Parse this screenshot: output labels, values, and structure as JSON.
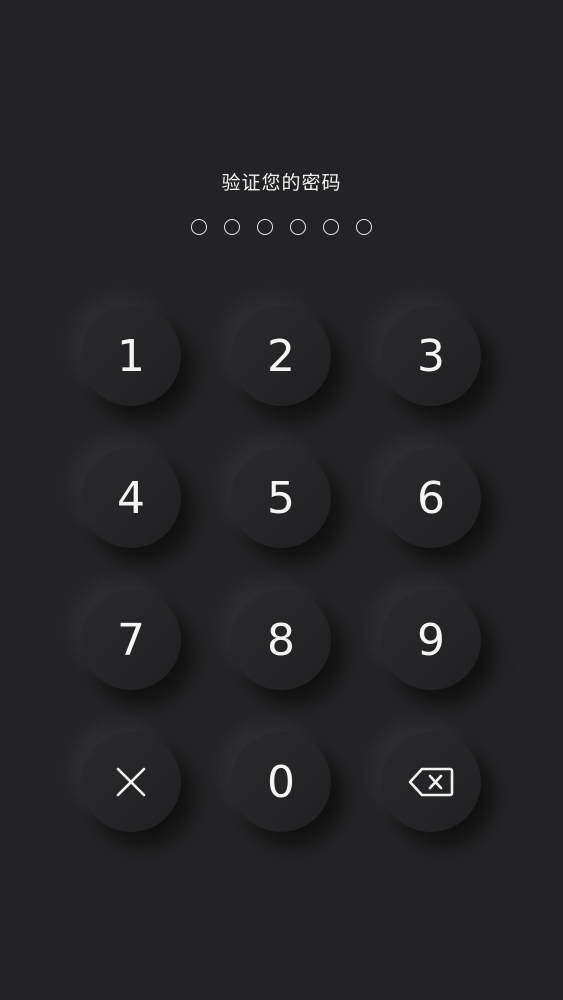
{
  "prompt": "验证您的密码",
  "passcode": {
    "length": 6,
    "entered": 0
  },
  "keypad": {
    "keys": [
      "1",
      "2",
      "3",
      "4",
      "5",
      "6",
      "7",
      "8",
      "9",
      "",
      "0",
      ""
    ],
    "clear_icon": "close-icon",
    "backspace_icon": "backspace-icon"
  },
  "colors": {
    "background": "#232224",
    "key": "#222123",
    "text": "#f4f4f4"
  }
}
